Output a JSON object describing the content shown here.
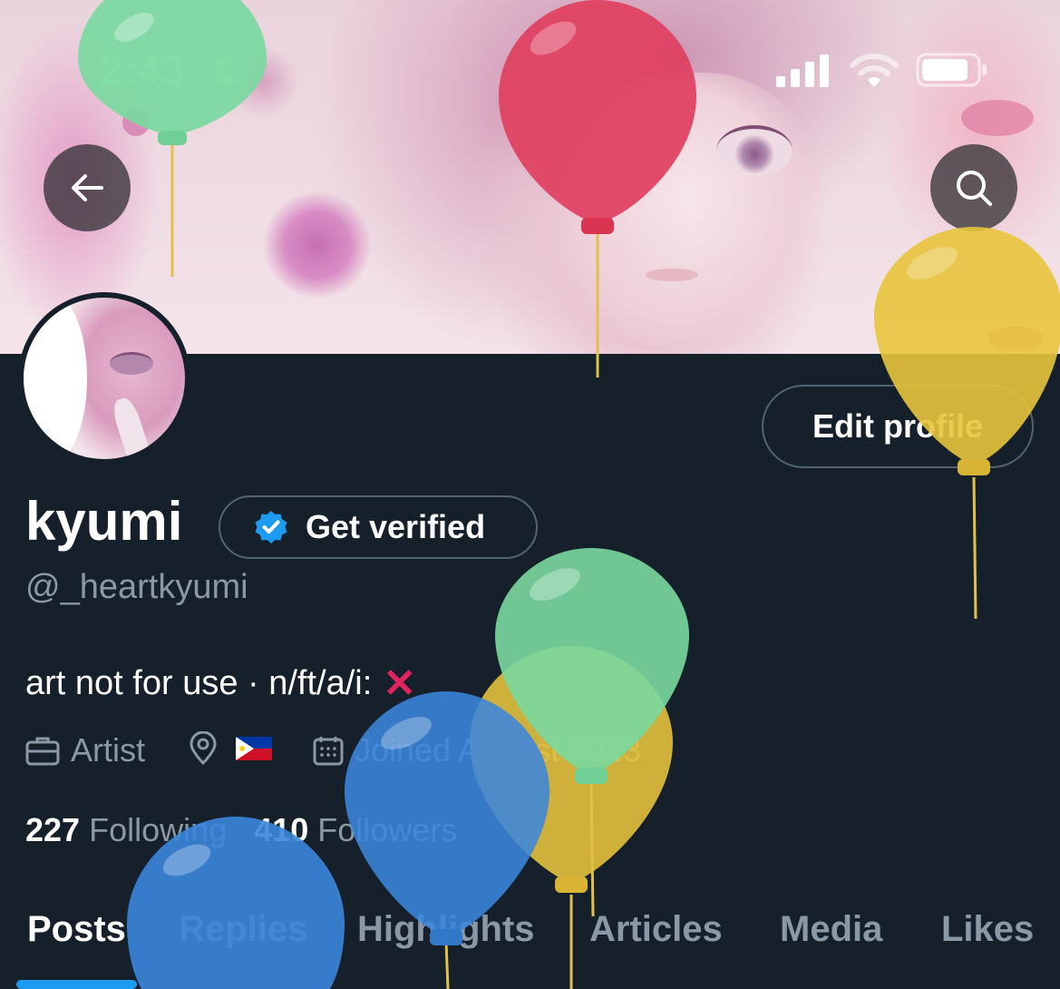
{
  "status_bar": {
    "time": "2:43"
  },
  "header": {
    "back_label": "Back",
    "search_label": "Search"
  },
  "profile": {
    "name": "kyumi",
    "handle": "@_heartkyumi",
    "bio": "art not for use · n/ft/a/i:",
    "bio_mark": "✕",
    "job": "Artist",
    "location_flag": "PH",
    "joined": "Joined August 2023",
    "following_count": "227",
    "following_label": "Following",
    "followers_count": "410",
    "followers_label": "Followers"
  },
  "actions": {
    "edit_profile": "Edit profile",
    "get_verified": "Get verified"
  },
  "tabs": [
    {
      "label": "Posts",
      "active": true
    },
    {
      "label": "Replies",
      "active": false
    },
    {
      "label": "Highlights",
      "active": false
    },
    {
      "label": "Articles",
      "active": false
    },
    {
      "label": "Media",
      "active": false
    },
    {
      "label": "Likes",
      "active": false
    }
  ],
  "colors": {
    "background": "#15202b",
    "accent": "#1d9bf0",
    "muted_text": "#8b98a5",
    "verified_badge": "#1d9bf0",
    "balloon_green": "#7ad9a0",
    "balloon_red": "#e03f5f",
    "balloon_yellow": "#e8c43c",
    "balloon_blue": "#3b86dd"
  },
  "overlay": {
    "type": "birthday balloons"
  }
}
